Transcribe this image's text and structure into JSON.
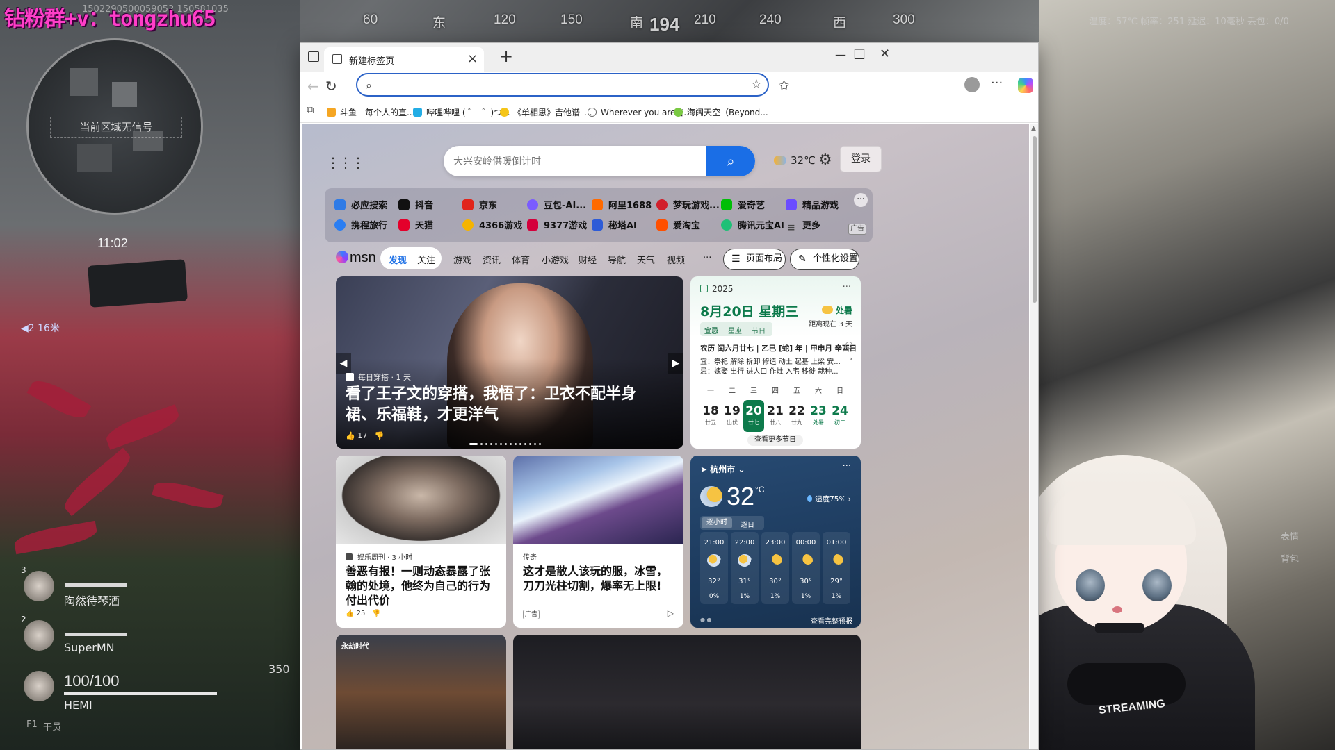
{
  "game": {
    "watermark": "钻粉群+v：tongzhu65",
    "watermark_sub": "1502290500059052 150581035",
    "compass": [
      "60",
      "东",
      "120",
      "150",
      "南",
      "194",
      "210",
      "240",
      "西",
      "300"
    ],
    "no_signal": "当前区域无信号",
    "clock": "11:02",
    "distance": "◀2 16米",
    "squad": [
      {
        "num": "3",
        "name": "陶然待琴酒"
      },
      {
        "num": "2",
        "name": "SuperMN"
      },
      {
        "num": "",
        "name": "HEMI"
      }
    ],
    "hp": "100/100",
    "ammo": "350",
    "stats": "温度：57℃  帧率：251  延迟：10毫秒  丢包：0/0",
    "hud_right": [
      "表情",
      "背包"
    ],
    "hud_left_bottom": [
      "F1",
      "干员"
    ],
    "vtuber_text": "STREAMING"
  },
  "browser": {
    "tab_title": "新建标签页",
    "address_value": "",
    "bookmarks": [
      {
        "label": "斗鱼 - 每个人的直...",
        "color": "#f5a623"
      },
      {
        "label": "哔哩哔哩 ( ゜- ゜)つ...",
        "color": "#23ade5"
      },
      {
        "label": "《单相思》吉他谱_...",
        "color": "#f5c518"
      },
      {
        "label": "Wherever you are吉...",
        "color": "#666666"
      },
      {
        "label": "海阔天空（Beyond...",
        "color": "#7ac943"
      }
    ]
  },
  "ntp": {
    "search_placeholder": "大兴安岭供暖倒计时",
    "weather_mini": "32℃",
    "login": "登录",
    "quicklinks": [
      {
        "label": "必应搜索",
        "color": "#2f7be6"
      },
      {
        "label": "抖音",
        "color": "#111111"
      },
      {
        "label": "京东",
        "color": "#e1251b"
      },
      {
        "label": "豆包-AI...",
        "color": "#7a5cff"
      },
      {
        "label": "阿里1688",
        "color": "#ff6a00"
      },
      {
        "label": "梦玩游戏...",
        "color": "#d11f2b"
      },
      {
        "label": "爱奇艺",
        "color": "#00be06"
      },
      {
        "label": "精品游戏",
        "color": "#6b4cff"
      },
      {
        "label": "携程旅行",
        "color": "#2b7ef2"
      },
      {
        "label": "天猫",
        "color": "#e4002b"
      },
      {
        "label": "4366游戏",
        "color": "#f5b400"
      },
      {
        "label": "9377游戏",
        "color": "#d4003b"
      },
      {
        "label": "秘塔AI",
        "color": "#2d5bd7"
      },
      {
        "label": "爱淘宝",
        "color": "#ff5000"
      },
      {
        "label": "腾讯元宝AI",
        "color": "#1fc077"
      },
      {
        "label": "更多",
        "color": "#444444"
      }
    ],
    "quicklinks_more": "···",
    "ad_tag": "广告",
    "msn_logo": "msn",
    "tabs": [
      "发现",
      "关注",
      "游戏",
      "资讯",
      "体育",
      "小游戏",
      "财经",
      "导航",
      "天气",
      "视频",
      "···"
    ],
    "layout_btn": "页面布局",
    "personalize_btn": "个性化设置",
    "hero": {
      "source": "每日穿搭 · 1 天",
      "title": "看了王子文的穿搭，我悟了：卫衣不配半身裙、乐福鞋，才更洋气",
      "likes": "17"
    },
    "calendar": {
      "year": "2025",
      "menu": "···",
      "date": "8月20日 星期三",
      "term": "处暑",
      "countdown": "距离现在 3 天",
      "tabs": [
        "宜忌",
        "星座",
        "节日"
      ],
      "lunar": "农历 闰六月廿七 | 乙巳 [蛇] 年 | 甲申月 辛酉日",
      "yi": "宜：祭祀 解除 拆卸 修造 动土 起基 上梁 安...",
      "ji": "忌：嫁娶 出行 进人口 作灶 入宅 移徙 栽种...",
      "weekdays": [
        "一",
        "二",
        "三",
        "四",
        "五",
        "六",
        "日"
      ],
      "days": [
        {
          "d": "18",
          "l": "廿五"
        },
        {
          "d": "19",
          "l": "出伏"
        },
        {
          "d": "20",
          "l": "廿七"
        },
        {
          "d": "21",
          "l": "廿八"
        },
        {
          "d": "22",
          "l": "廿九"
        },
        {
          "d": "23",
          "l": "处暑"
        },
        {
          "d": "24",
          "l": "初二"
        }
      ],
      "more": "查看更多节日"
    },
    "cards": [
      {
        "source": "娱乐周刊 · 3 小时",
        "title": "善恶有报！一则动态暴露了张翰的处境，他终为自己的行为付出代价",
        "likes": "25"
      },
      {
        "source": "传奇",
        "title": "这才是散人该玩的服，冰雪，刀刀光柱切割，爆率无上限!",
        "ad": "广告"
      }
    ],
    "weather": {
      "city": "杭州市",
      "menu": "···",
      "temp": "32",
      "unit": "°C",
      "humidity": "湿度75%",
      "tabs": [
        "逐小时",
        "逐日"
      ],
      "hours": [
        {
          "t": "21:00",
          "temp": "32°",
          "rain": "0%"
        },
        {
          "t": "22:00",
          "temp": "31°",
          "rain": "1%"
        },
        {
          "t": "23:00",
          "temp": "30°",
          "rain": "1%"
        },
        {
          "t": "00:00",
          "temp": "30°",
          "rain": "1%"
        },
        {
          "t": "01:00",
          "temp": "29°",
          "rain": "1%"
        }
      ],
      "full": "查看完整预报"
    },
    "bottom_label": "永劫时代"
  }
}
